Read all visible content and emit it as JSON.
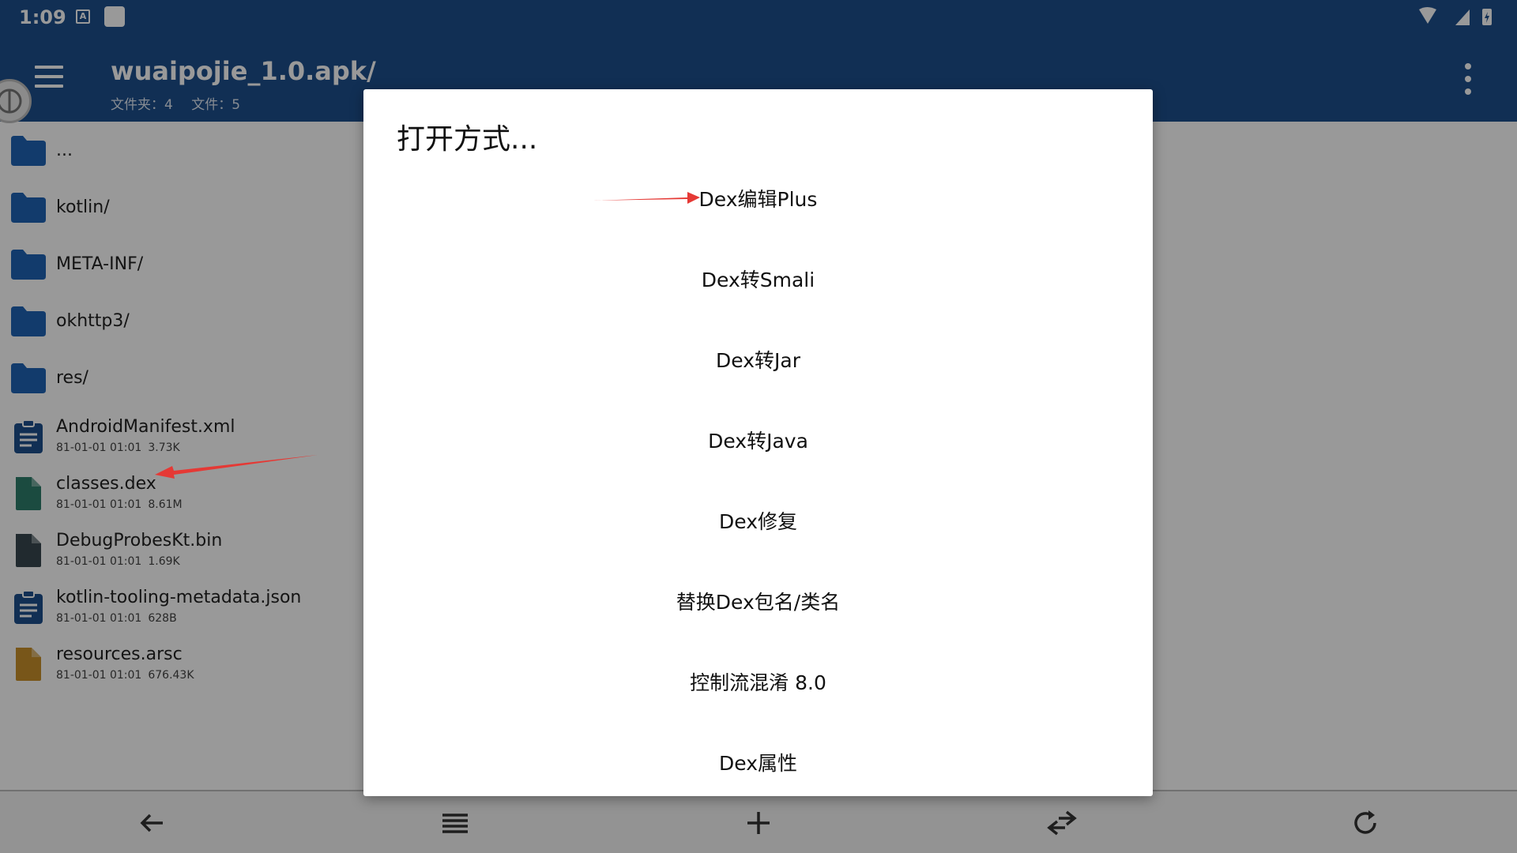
{
  "status_bar": {
    "time": "1:09",
    "notification_icon_label": "A"
  },
  "app_bar": {
    "title": "wuaipojie_1.0.apk/",
    "folders_label": "文件夹：4",
    "files_label": "文件：5"
  },
  "files": [
    {
      "name": "...",
      "type": "folder",
      "date": "",
      "size": ""
    },
    {
      "name": "kotlin/",
      "type": "folder",
      "date": "",
      "size": ""
    },
    {
      "name": "META-INF/",
      "type": "folder",
      "date": "",
      "size": ""
    },
    {
      "name": "okhttp3/",
      "type": "folder",
      "date": "",
      "size": ""
    },
    {
      "name": "res/",
      "type": "folder",
      "date": "",
      "size": ""
    },
    {
      "name": "AndroidManifest.xml",
      "type": "xml",
      "date": "81-01-01 01:01",
      "size": "3.73K"
    },
    {
      "name": "classes.dex",
      "type": "dex",
      "date": "81-01-01 01:01",
      "size": "8.61M"
    },
    {
      "name": "DebugProbesKt.bin",
      "type": "bin",
      "date": "81-01-01 01:01",
      "size": "1.69K"
    },
    {
      "name": "kotlin-tooling-metadata.json",
      "type": "json",
      "date": "81-01-01 01:01",
      "size": "628B"
    },
    {
      "name": "resources.arsc",
      "type": "arsc",
      "date": "81-01-01 01:01",
      "size": "676.43K"
    }
  ],
  "dialog": {
    "title": "打开方式...",
    "options": [
      "Dex编辑Plus",
      "Dex转Smali",
      "Dex转Jar",
      "Dex转Java",
      "Dex修复",
      "替换Dex包名/类名",
      "控制流混淆 8.0",
      "Dex属性"
    ]
  },
  "colors": {
    "primary": "#1d4f8c",
    "folder": "#1e63b5",
    "xml_icon": "#1d4f8c",
    "dex_icon": "#2e7d6b",
    "bin_icon": "#37474f",
    "arsc_icon": "#c8902a",
    "annotation_arrow": "#e53935"
  }
}
